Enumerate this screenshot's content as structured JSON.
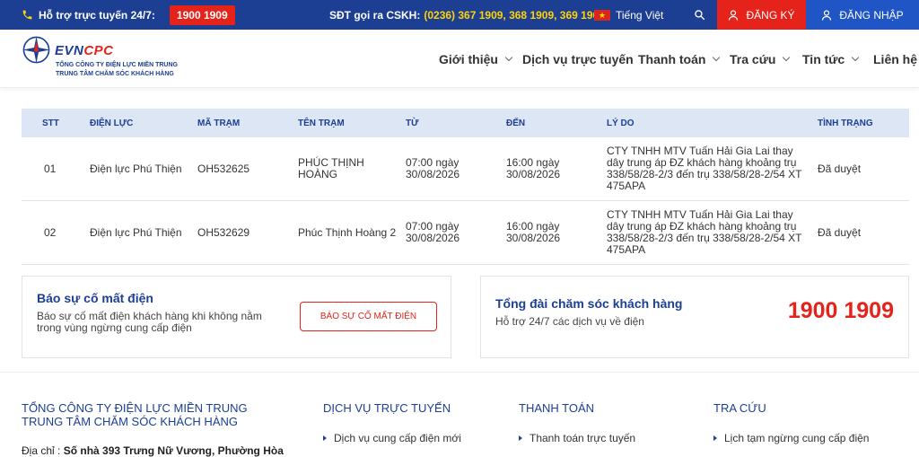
{
  "topbar": {
    "hotline_label": "Hỗ trợ trực tuyến 24/7:",
    "hotline_number": "1900 1909",
    "cskh_label": "SĐT gọi ra CSKH:",
    "cskh_numbers": "(0236) 367 1909, 368 1909, 369 1909",
    "language": "Tiếng Việt",
    "register_label": "ĐĂNG KÝ",
    "login_label": "ĐĂNG NHẬP",
    "icons": {
      "phone": "phone-icon",
      "search": "search-icon",
      "user": "user-icon",
      "flag": "vietnam-flag-icon"
    }
  },
  "header": {
    "logo_name_evn": "EVN",
    "logo_name_cpc": "CPC",
    "logo_sub1": "TỔNG CÔNG TY ĐIỆN LỰC MIỀN TRUNG",
    "logo_sub2": "TRUNG TÂM CHĂM SÓC KHÁCH HÀNG",
    "nav": [
      {
        "label": "Giới thiệu",
        "has_dropdown": true
      },
      {
        "label": "Dịch vụ trực tuyến",
        "has_dropdown": false
      },
      {
        "label": "Thanh toán",
        "has_dropdown": true
      },
      {
        "label": "Tra cứu",
        "has_dropdown": true
      },
      {
        "label": "Tin tức",
        "has_dropdown": true
      },
      {
        "label": "Liên hệ",
        "has_dropdown": false
      }
    ]
  },
  "table": {
    "headers": [
      "STT",
      "ĐIỆN LỰC",
      "MÃ TRẠM",
      "TÊN TRẠM",
      "TỪ",
      "ĐẾN",
      "LÝ DO",
      "TÌNH TRẠNG"
    ],
    "rows": [
      {
        "stt": "01",
        "dien_luc": "Điện lực Phú Thiện",
        "ma_tram": "OH532625",
        "ten_tram": "PHÚC THỊNH HOÀNG",
        "tu": "07:00 ngày 30/08/2026",
        "den": "16:00 ngày 30/08/2026",
        "ly_do": "CTY TNHH MTV Tuấn Hải Gia Lai thay dây trung áp ĐZ khách hàng khoảng trụ 338/58/28-2/3 đến trụ 338/58/28-2/54 XT 475APA",
        "tinh_trang": "Đã duyệt"
      },
      {
        "stt": "02",
        "dien_luc": "Điện lực Phú Thiện",
        "ma_tram": "OH532629",
        "ten_tram": "Phúc Thịnh Hoàng 2",
        "tu": "07:00 ngày 30/08/2026",
        "den": "16:00 ngày 30/08/2026",
        "ly_do": "CTY TNHH MTV Tuấn Hải Gia Lai thay dây trung áp ĐZ khách hàng khoảng trụ 338/58/28-2/3 đến trụ 338/58/28-2/54 XT 475APA",
        "tinh_trang": "Đã duyệt"
      }
    ]
  },
  "report_card": {
    "title": "Báo sự cố mất điện",
    "description": "Báo sự cố mất điện khách hàng khi không nằm trong vùng ngừng cung cấp điện",
    "button_label": "BÁO SỰ CỐ MẤT ĐIỆN"
  },
  "support_card": {
    "title": "Tổng đài chăm sóc khách hàng",
    "description": "Hỗ trợ 24/7 các dịch vụ về điện",
    "phone": "1900 1909"
  },
  "footer": {
    "company_line1": "TỔNG CÔNG TY ĐIỆN LỰC MIỀN TRUNG",
    "company_line2": "TRUNG TÂM CHĂM SÓC KHÁCH HÀNG",
    "address_label": "Địa chỉ :",
    "address_value": "Số nhà 393 Trưng Nữ Vương, Phường Hòa",
    "columns": [
      {
        "heading": "DỊCH VỤ TRỰC TUYẾN",
        "link": "Dịch vụ cung cấp điện mới"
      },
      {
        "heading": "THANH TOÁN",
        "link": "Thanh toán trực tuyến"
      },
      {
        "heading": "TRA CỨU",
        "link": "Lịch tạm ngừng cung cấp điện"
      }
    ]
  },
  "colors": {
    "primary": "#1c3f94",
    "accent": "#e5231b",
    "highlight": "#ffd400",
    "table_header_bg": "#dde6f4"
  }
}
